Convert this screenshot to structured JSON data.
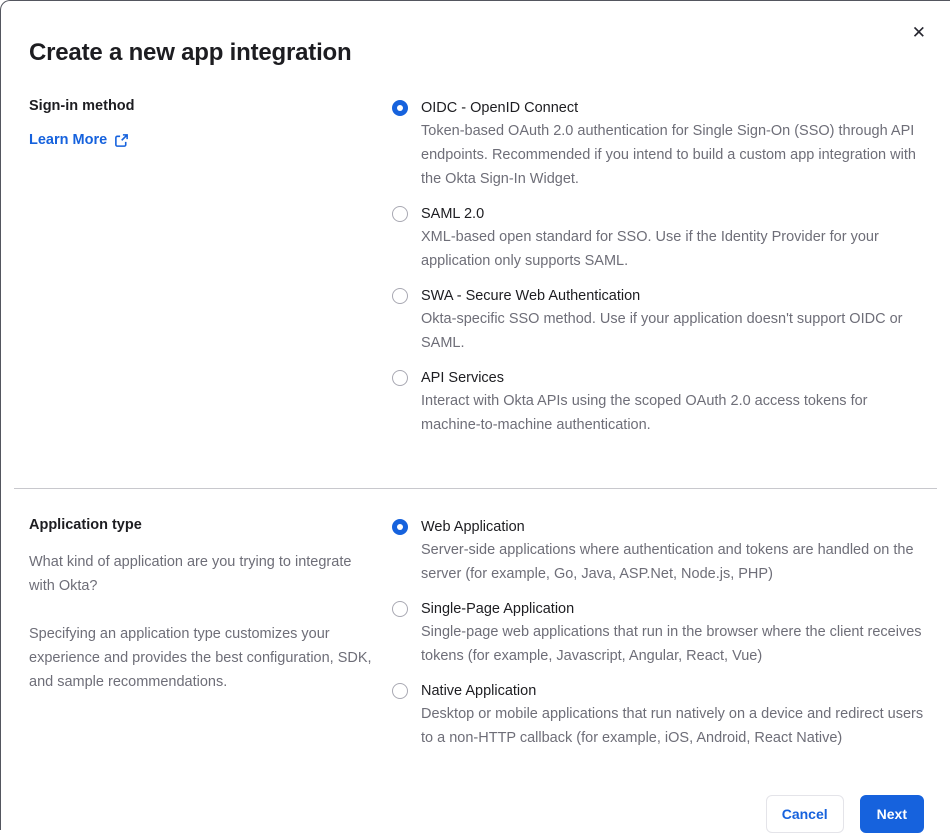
{
  "modal": {
    "title": "Create a new app integration",
    "close_icon": "✕"
  },
  "colors": {
    "accent_blue": "#1662dd",
    "heading_text": "#1d1d21",
    "body_text": "#6e6e78",
    "divider": "#c8c8cd",
    "modal_border": "#54565f",
    "radio_unselected_border": "#a9a9b3"
  },
  "sections": [
    {
      "label": "Sign-in method",
      "link": {
        "text": "Learn More",
        "icon": "external-link-icon"
      },
      "options": [
        {
          "title": "OIDC - OpenID Connect",
          "description": "Token-based OAuth 2.0 authentication for Single Sign-On (SSO) through API endpoints. Recommended if you intend to build a custom app integration with the Okta Sign-In Widget.",
          "selected": true
        },
        {
          "title": "SAML 2.0",
          "description": "XML-based open standard for SSO. Use if the Identity Provider for your application only supports SAML.",
          "selected": false
        },
        {
          "title": "SWA - Secure Web Authentication",
          "description": "Okta-specific SSO method. Use if your application doesn't support OIDC or SAML.",
          "selected": false
        },
        {
          "title": "API Services",
          "description": "Interact with Okta APIs using the scoped OAuth 2.0 access tokens for machine-to-machine authentication.",
          "selected": false
        }
      ]
    },
    {
      "label": "Application type",
      "paragraphs": [
        "What kind of application are you trying to integrate with Okta?",
        "Specifying an application type customizes your experience and provides the best configuration, SDK, and sample recommendations."
      ],
      "options": [
        {
          "title": "Web Application",
          "description": "Server-side applications where authentication and tokens are handled on the server (for example, Go, Java, ASP.Net, Node.js, PHP)",
          "selected": true
        },
        {
          "title": "Single-Page Application",
          "description": "Single-page web applications that run in the browser where the client receives tokens (for example, Javascript, Angular, React, Vue)",
          "selected": false
        },
        {
          "title": "Native Application",
          "description": "Desktop or mobile applications that run natively on a device and redirect users to a non-HTTP callback (for example, iOS, Android, React Native)",
          "selected": false
        }
      ]
    }
  ],
  "footer": {
    "cancel_label": "Cancel",
    "next_label": "Next"
  }
}
